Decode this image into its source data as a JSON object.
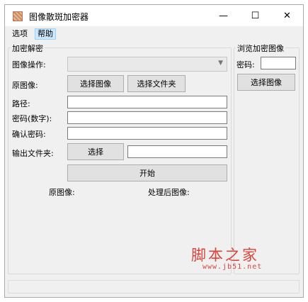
{
  "window": {
    "title": "图像散斑加密器",
    "minimize_glyph": "—",
    "maximize_glyph": "☐",
    "close_glyph": "✕"
  },
  "menu": {
    "items": [
      {
        "label": "选项"
      },
      {
        "label": "帮助"
      }
    ]
  },
  "encrypt_group": {
    "title": "加密解密",
    "operation_label": "图像操作:",
    "operation_value": "",
    "original_label": "原图像:",
    "select_image_button": "选择图像",
    "select_folder_button": "选择文件夹",
    "path_label": "路径:",
    "path_value": "",
    "password_label": "密码(数字):",
    "password_value": "",
    "confirm_label": "确认密码:",
    "confirm_value": "",
    "output_label": "输出文件夹:",
    "output_select_button": "选择",
    "output_value": "",
    "start_button": "开始",
    "original_preview_label": "原图像:",
    "processed_preview_label": "处理后图像:"
  },
  "browse_group": {
    "title": "浏览加密图像",
    "password_label": "密码:",
    "password_value": "",
    "select_image_button": "选择图像"
  },
  "watermark": {
    "text": "脚本之家",
    "url": "www.jb51.net",
    "color": "#d9443a"
  }
}
